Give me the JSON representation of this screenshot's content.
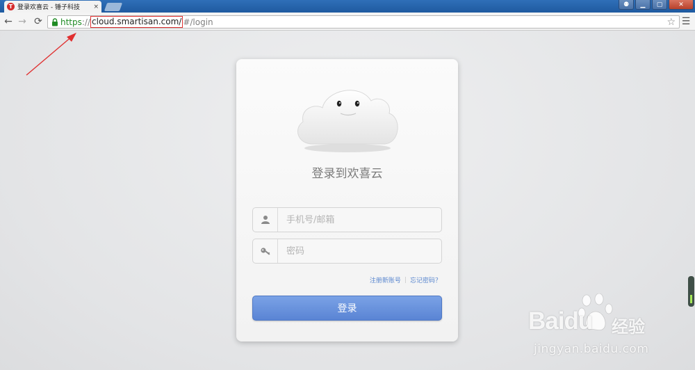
{
  "browser": {
    "tab": {
      "title": "登录欢喜云 - 锤子科技",
      "favicon_letter": "T",
      "close": "×"
    },
    "window_controls": {
      "user": "⚉",
      "minimize": "▁",
      "maximize": "▢",
      "close": "✕"
    },
    "nav": {
      "back": "←",
      "forward": "→",
      "reload": "⟳"
    },
    "url": {
      "scheme": "https",
      "separator": "://",
      "host": "cloud.smartisan.com/",
      "path": "#/login"
    },
    "menu_icon": "☰",
    "star_icon": "☆"
  },
  "login": {
    "title": "登录到欢喜云",
    "phone_placeholder": "手机号/邮箱",
    "password_placeholder": "密码",
    "register_link": "注册新账号",
    "link_divider": "|",
    "forgot_link": "忘记密码？",
    "submit_label": "登录"
  },
  "watermark": {
    "brand": "Baidu",
    "sub": "经验",
    "url": "jingyan.baidu.com"
  },
  "icons": {
    "lock": "lock-icon",
    "user": "user-icon",
    "key": "key-icon",
    "cloud": "cloud-mascot-icon"
  },
  "colors": {
    "accent_button": "#6b94dc",
    "link": "#5a87cf",
    "url_scheme": "#1f8b24",
    "annotation": "#e03030"
  }
}
